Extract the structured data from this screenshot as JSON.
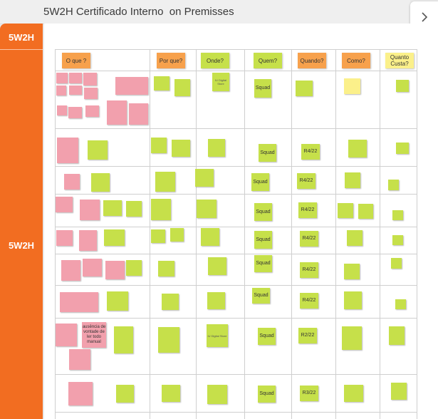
{
  "app": {
    "title": "5W2H Certificado Interno  on Premisses"
  },
  "sidebar": {
    "top_label": "5W2H",
    "mid_label": "5W2H",
    "color": "#f26d21"
  },
  "columns": [
    {
      "label": "O que ?"
    },
    {
      "label": "Por que?"
    },
    {
      "label": "Onde?"
    },
    {
      "label": "Quem?"
    },
    {
      "label": "Quando?"
    },
    {
      "label": "Como?"
    },
    {
      "label": "Quanto Custa?"
    }
  ],
  "notes": {
    "r1_onde": "IU Digital Store",
    "r1_quem": "Squad",
    "r2_quem": "Squad",
    "r2_quando": "R4/22",
    "r3_quem": "Squad",
    "r3_quando": "R4/22",
    "r4_quem": "Squad",
    "r4_quando": "R4/22",
    "r5_quem": "Squad",
    "r5_quando": "R4/22",
    "r6_quem": "Squad",
    "r6_quando": "R4/22",
    "r7_quem": "Squad",
    "r7_quando": "R4/22",
    "r8_oque": "ausência de vontade de ler todo manual",
    "r8_onde": "IU Digital Store",
    "r8_quem": "Squad",
    "r8_quando": "R2/22",
    "r9_quem": "Squad",
    "r9_quando": "R3/22"
  },
  "colors": {
    "pink": "#f2a0ad",
    "green": "#c6e04a",
    "orange_header": "#f7a14c",
    "yellow_header": "#fbf08a"
  },
  "icons": {
    "next": "chevron-right-icon"
  }
}
